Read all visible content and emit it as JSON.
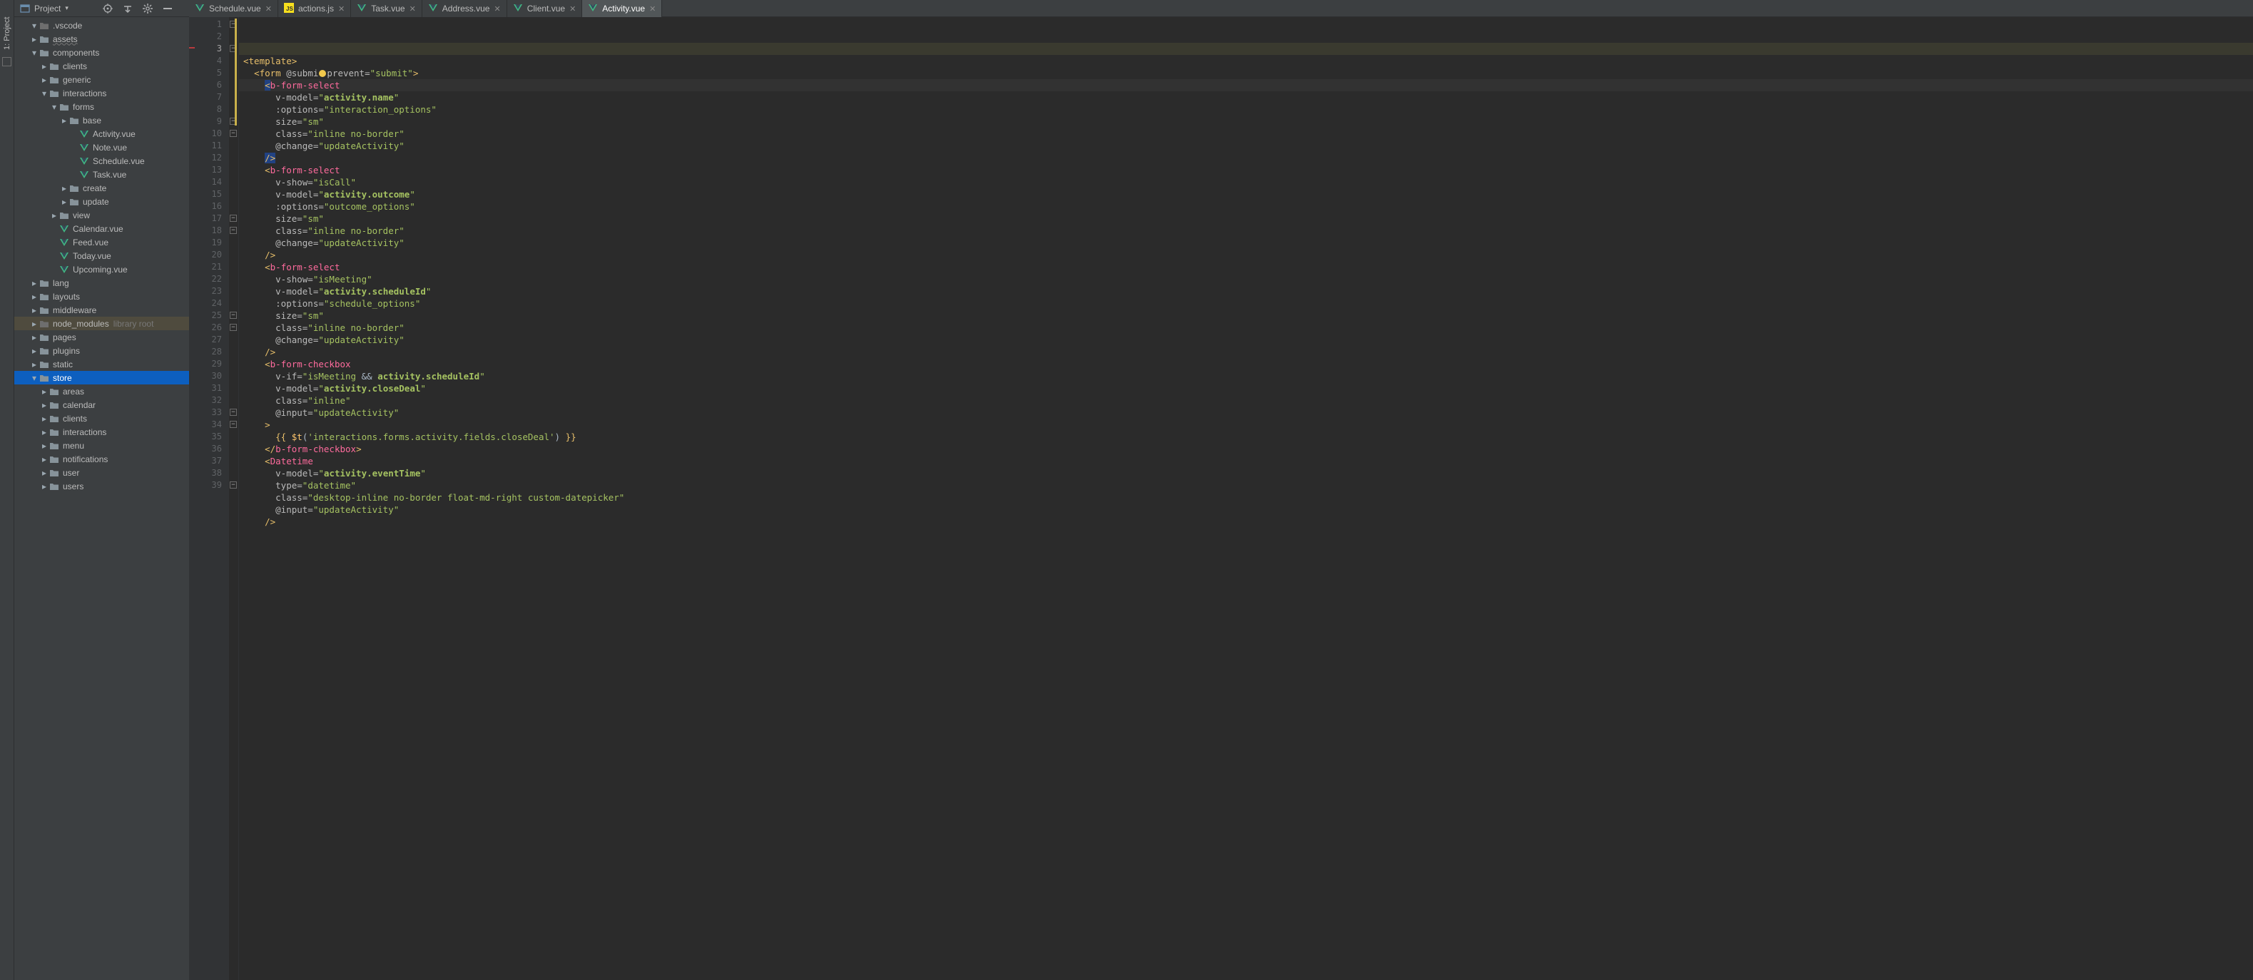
{
  "toolStripe": {
    "label": "1: Project"
  },
  "projectSelector": {
    "label": "Project",
    "arrow": "▾"
  },
  "tabs": [
    {
      "name": "Schedule.vue",
      "kind": "vue",
      "active": false
    },
    {
      "name": "actions.js",
      "kind": "js",
      "active": false
    },
    {
      "name": "Task.vue",
      "kind": "vue",
      "active": false
    },
    {
      "name": "Address.vue",
      "kind": "vue",
      "active": false
    },
    {
      "name": "Client.vue",
      "kind": "vue",
      "active": false
    },
    {
      "name": "Activity.vue",
      "kind": "vue",
      "active": true
    }
  ],
  "tree": [
    {
      "depth": 1,
      "arrow": "expanded",
      "icon": "folder-dim",
      "label": ".vscode"
    },
    {
      "depth": 1,
      "arrow": "collapsed",
      "icon": "folder",
      "label": "assets",
      "underline": true
    },
    {
      "depth": 1,
      "arrow": "expanded",
      "icon": "folder",
      "label": "components"
    },
    {
      "depth": 2,
      "arrow": "collapsed",
      "icon": "folder",
      "label": "clients"
    },
    {
      "depth": 2,
      "arrow": "collapsed",
      "icon": "folder",
      "label": "generic"
    },
    {
      "depth": 2,
      "arrow": "expanded",
      "icon": "folder",
      "label": "interactions"
    },
    {
      "depth": 3,
      "arrow": "expanded",
      "icon": "folder",
      "label": "forms"
    },
    {
      "depth": 4,
      "arrow": "collapsed",
      "icon": "folder",
      "label": "base"
    },
    {
      "depth": 5,
      "arrow": "none",
      "icon": "vue",
      "label": "Activity.vue"
    },
    {
      "depth": 5,
      "arrow": "none",
      "icon": "vue",
      "label": "Note.vue"
    },
    {
      "depth": 5,
      "arrow": "none",
      "icon": "vue",
      "label": "Schedule.vue"
    },
    {
      "depth": 5,
      "arrow": "none",
      "icon": "vue",
      "label": "Task.vue"
    },
    {
      "depth": 4,
      "arrow": "collapsed",
      "icon": "folder",
      "label": "create"
    },
    {
      "depth": 4,
      "arrow": "collapsed",
      "icon": "folder",
      "label": "update"
    },
    {
      "depth": 3,
      "arrow": "collapsed",
      "icon": "folder",
      "label": "view"
    },
    {
      "depth": 3,
      "arrow": "none",
      "icon": "vue",
      "label": "Calendar.vue"
    },
    {
      "depth": 3,
      "arrow": "none",
      "icon": "vue",
      "label": "Feed.vue"
    },
    {
      "depth": 3,
      "arrow": "none",
      "icon": "vue",
      "label": "Today.vue"
    },
    {
      "depth": 3,
      "arrow": "none",
      "icon": "vue",
      "label": "Upcoming.vue"
    },
    {
      "depth": 1,
      "arrow": "collapsed",
      "icon": "folder",
      "label": "lang"
    },
    {
      "depth": 1,
      "arrow": "collapsed",
      "icon": "folder",
      "label": "layouts"
    },
    {
      "depth": 1,
      "arrow": "collapsed",
      "icon": "folder",
      "label": "middleware"
    },
    {
      "depth": 1,
      "arrow": "collapsed",
      "icon": "folder-dim",
      "label": "node_modules",
      "extra": "library root",
      "lib": true
    },
    {
      "depth": 1,
      "arrow": "collapsed",
      "icon": "folder",
      "label": "pages"
    },
    {
      "depth": 1,
      "arrow": "collapsed",
      "icon": "folder",
      "label": "plugins"
    },
    {
      "depth": 1,
      "arrow": "collapsed",
      "icon": "folder",
      "label": "static"
    },
    {
      "depth": 1,
      "arrow": "expanded",
      "icon": "folder",
      "label": "store",
      "selected": true
    },
    {
      "depth": 2,
      "arrow": "collapsed",
      "icon": "folder",
      "label": "areas"
    },
    {
      "depth": 2,
      "arrow": "collapsed",
      "icon": "folder",
      "label": "calendar"
    },
    {
      "depth": 2,
      "arrow": "collapsed",
      "icon": "folder",
      "label": "clients"
    },
    {
      "depth": 2,
      "arrow": "collapsed",
      "icon": "folder",
      "label": "interactions"
    },
    {
      "depth": 2,
      "arrow": "collapsed",
      "icon": "folder",
      "label": "menu"
    },
    {
      "depth": 2,
      "arrow": "collapsed",
      "icon": "folder",
      "label": "notifications"
    },
    {
      "depth": 2,
      "arrow": "collapsed",
      "icon": "folder",
      "label": "user"
    },
    {
      "depth": 2,
      "arrow": "collapsed",
      "icon": "folder",
      "label": "users"
    }
  ],
  "code": {
    "lines": [
      {
        "n": 1,
        "html": "<span class='c-tag'>&lt;template&gt;</span>"
      },
      {
        "n": 2,
        "html": "  <span class='c-tag'>&lt;form</span> <span class='c-attr'>@submi</span><span style='background:#f2c94c;border-radius:50%;display:inline-block;width:10px;height:10px;margin:0 1px -1px 1px'></span><span class='c-attr'>prevent=</span><span class='c-str'>\"submit\"</span><span class='c-tag'>&gt;</span>"
      },
      {
        "n": 3,
        "html": "    <span class='c-tag' style='background:#214283'>&lt;</span><span class='c-comp'>b-form-select</span>",
        "current": true
      },
      {
        "n": 4,
        "html": "      <span class='c-attr'>v-model=</span><span class='c-str'>\"</span><span class='c-str' style='font-weight:bold'>activity.name</span><span class='c-str'>\"</span>"
      },
      {
        "n": 5,
        "html": "      <span class='c-attr'>:options=</span><span class='c-str'>\"interaction_options\"</span>"
      },
      {
        "n": 6,
        "html": "      <span class='c-attr'>size=</span><span class='c-str'>\"sm\"</span>"
      },
      {
        "n": 7,
        "html": "      <span class='c-attr'>class=</span><span class='c-str'>\"inline no-border\"</span>"
      },
      {
        "n": 8,
        "html": "      <span class='c-attr'>@change=</span><span class='c-str'>\"updateActivity\"</span>"
      },
      {
        "n": 9,
        "html": "    <span class='c-tag' style='background:#214283'>/&gt;</span>"
      },
      {
        "n": 10,
        "html": "    <span class='c-tag'>&lt;</span><span class='c-comp'>b-form-select</span>"
      },
      {
        "n": 11,
        "html": "      <span class='c-attr'>v-show=</span><span class='c-str'>\"isCall\"</span>"
      },
      {
        "n": 12,
        "html": "      <span class='c-attr'>v-model=</span><span class='c-str'>\"</span><span class='c-str' style='font-weight:bold'>activity.outcome</span><span class='c-str'>\"</span>"
      },
      {
        "n": 13,
        "html": "      <span class='c-attr'>:options=</span><span class='c-str'>\"outcome_options\"</span>"
      },
      {
        "n": 14,
        "html": "      <span class='c-attr'>size=</span><span class='c-str'>\"sm\"</span>"
      },
      {
        "n": 15,
        "html": "      <span class='c-attr'>class=</span><span class='c-str'>\"inline no-border\"</span>"
      },
      {
        "n": 16,
        "html": "      <span class='c-attr'>@change=</span><span class='c-str'>\"updateActivity\"</span>"
      },
      {
        "n": 17,
        "html": "    <span class='c-tag'>/&gt;</span>"
      },
      {
        "n": 18,
        "html": "    <span class='c-tag'>&lt;</span><span class='c-comp'>b-form-select</span>"
      },
      {
        "n": 19,
        "html": "      <span class='c-attr'>v-show=</span><span class='c-str'>\"isMeeting\"</span>"
      },
      {
        "n": 20,
        "html": "      <span class='c-attr'>v-model=</span><span class='c-str'>\"</span><span class='c-str' style='font-weight:bold'>activity.scheduleId</span><span class='c-str'>\"</span>"
      },
      {
        "n": 21,
        "html": "      <span class='c-attr'>:options=</span><span class='c-str'>\"schedule_options\"</span>"
      },
      {
        "n": 22,
        "html": "      <span class='c-attr'>size=</span><span class='c-str'>\"sm\"</span>"
      },
      {
        "n": 23,
        "html": "      <span class='c-attr'>class=</span><span class='c-str'>\"inline no-border\"</span>"
      },
      {
        "n": 24,
        "html": "      <span class='c-attr'>@change=</span><span class='c-str'>\"updateActivity\"</span>"
      },
      {
        "n": 25,
        "html": "    <span class='c-tag'>/&gt;</span>"
      },
      {
        "n": 26,
        "html": "    <span class='c-tag'>&lt;</span><span class='c-comp'>b-form-checkbox</span>"
      },
      {
        "n": 27,
        "html": "      <span class='c-attr'>v-if=</span><span class='c-str'>\"isMeeting </span><span class='c-op'>&amp;&amp;</span><span class='c-str'> </span><span class='c-str' style='font-weight:bold'>activity.scheduleId</span><span class='c-str'>\"</span>"
      },
      {
        "n": 28,
        "html": "      <span class='c-attr'>v-model=</span><span class='c-str'>\"</span><span class='c-str' style='font-weight:bold'>activity.closeDeal</span><span class='c-str'>\"</span>"
      },
      {
        "n": 29,
        "html": "      <span class='c-attr'>class=</span><span class='c-str'>\"inline\"</span>"
      },
      {
        "n": 30,
        "html": "      <span class='c-attr'>@input=</span><span class='c-str'>\"updateActivity\"</span>"
      },
      {
        "n": 31,
        "html": "    <span class='c-tag'>&gt;</span>"
      },
      {
        "n": 32,
        "html": "      <span class='c-brace'>{{</span> <span class='c-fn'>$t</span><span class='c-op'>(</span><span class='c-str'>'interactions.forms.activity.fields.closeDeal'</span><span class='c-op'>)</span> <span class='c-brace'>}}</span>"
      },
      {
        "n": 33,
        "html": "    <span class='c-tag'>&lt;/</span><span class='c-comp'>b-form-checkbox</span><span class='c-tag'>&gt;</span>"
      },
      {
        "n": 34,
        "html": "    <span class='c-tag'>&lt;</span><span class='c-comp'>Datetime</span>"
      },
      {
        "n": 35,
        "html": "      <span class='c-attr'>v-model=</span><span class='c-str'>\"</span><span class='c-str' style='font-weight:bold'>activity.eventTime</span><span class='c-str'>\"</span>"
      },
      {
        "n": 36,
        "html": "      <span class='c-attr'>type=</span><span class='c-str'>\"datetime\"</span>"
      },
      {
        "n": 37,
        "html": "      <span class='c-attr'>class=</span><span class='c-str'>\"desktop-inline no-border float-md-right custom-datepicker\"</span>"
      },
      {
        "n": 38,
        "html": "      <span class='c-attr'>@input=</span><span class='c-str'>\"updateActivity\"</span>"
      },
      {
        "n": 39,
        "html": "    <span class='c-tag'>/&gt;</span>"
      }
    ],
    "foldMarks": [
      1,
      3,
      9,
      10,
      17,
      18,
      25,
      26,
      33,
      34,
      39
    ]
  }
}
